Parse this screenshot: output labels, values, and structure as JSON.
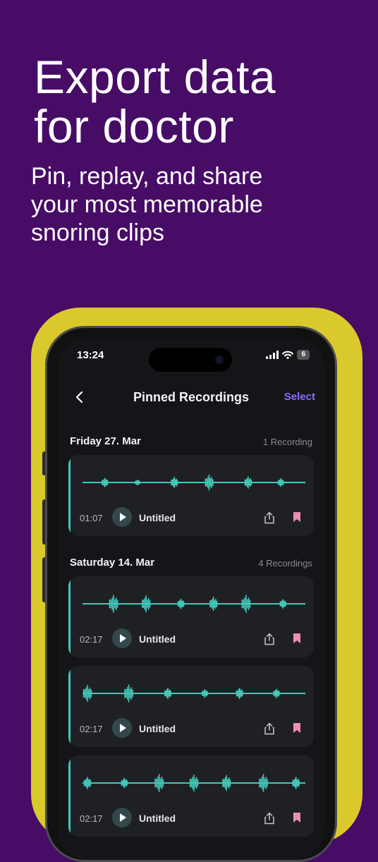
{
  "promo": {
    "headline_line1": "Export data",
    "headline_line2": "for doctor",
    "subhead_line1": "Pin, replay, and share",
    "subhead_line2": "your most memorable",
    "subhead_line3": "snoring clips"
  },
  "status_bar": {
    "time": "13:24",
    "battery": "6"
  },
  "nav": {
    "title": "Pinned Recordings",
    "select_label": "Select"
  },
  "sections": [
    {
      "date": "Friday 27. Mar",
      "count": "1 Recording"
    },
    {
      "date": "Saturday 14. Mar",
      "count": "4 Recordings"
    }
  ],
  "recordings": [
    {
      "duration": "01:07",
      "name": "Untitled",
      "bursts": [
        [
          0.09,
          0.45
        ],
        [
          0.24,
          0.25
        ],
        [
          0.41,
          0.55
        ],
        [
          0.57,
          0.8
        ],
        [
          0.75,
          0.6
        ],
        [
          0.9,
          0.4
        ]
      ]
    },
    {
      "duration": "02:17",
      "name": "Untitled",
      "bursts": [
        [
          0.13,
          0.9
        ],
        [
          0.28,
          0.85
        ],
        [
          0.44,
          0.5
        ],
        [
          0.59,
          0.7
        ],
        [
          0.74,
          0.9
        ],
        [
          0.91,
          0.45
        ]
      ]
    },
    {
      "duration": "02:17",
      "name": "Untitled",
      "bursts": [
        [
          0.01,
          0.85
        ],
        [
          0.2,
          0.9
        ],
        [
          0.38,
          0.55
        ],
        [
          0.55,
          0.4
        ],
        [
          0.71,
          0.55
        ],
        [
          0.88,
          0.45
        ]
      ]
    },
    {
      "duration": "02:17",
      "name": "Untitled",
      "bursts": [
        [
          0.01,
          0.6
        ],
        [
          0.18,
          0.5
        ],
        [
          0.34,
          0.9
        ],
        [
          0.5,
          0.85
        ],
        [
          0.65,
          0.8
        ],
        [
          0.82,
          0.9
        ],
        [
          0.97,
          0.6
        ]
      ]
    }
  ],
  "colors": {
    "background": "#470c66",
    "frame": "#dac92c",
    "accent": "#43c7b8",
    "select": "#8d6bff",
    "bookmark": "#f08cb0"
  }
}
